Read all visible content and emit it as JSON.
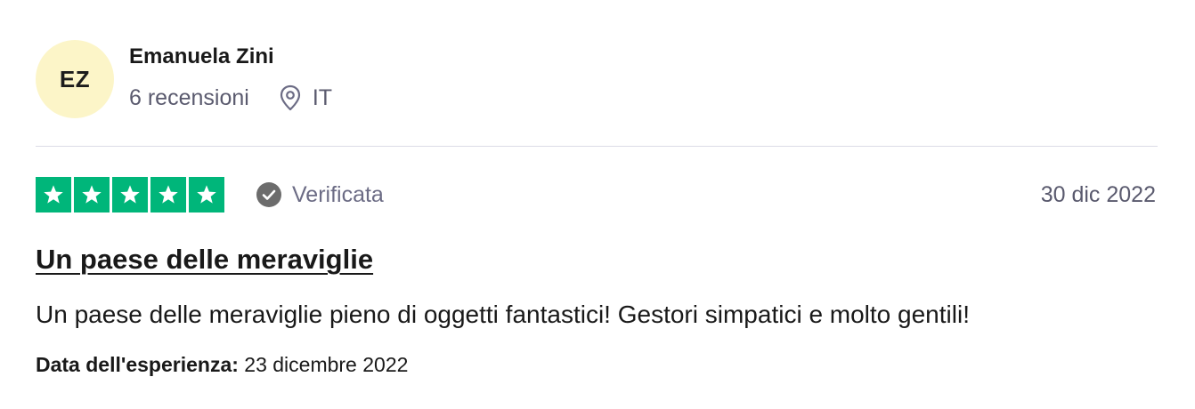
{
  "reviewer": {
    "initials": "EZ",
    "name": "Emanuela Zini",
    "reviews_count": "6 recensioni",
    "country": "IT",
    "location_icon": "location-pin-icon",
    "avatar_bg": "#fcf5c8"
  },
  "review": {
    "rating": 5,
    "rating_max": 5,
    "star_color": "#00b67a",
    "star_icon": "star-icon",
    "verified_label": "Verificata",
    "verified_icon": "check-circle-icon",
    "date": "30 dic 2022",
    "title": "Un paese delle meraviglie",
    "body": "Un paese delle meraviglie pieno di oggetti fantastici! Gestori simpatici e molto gentili!",
    "experience_label": "Data dell'esperienza:",
    "experience_date": "23 dicembre 2022"
  }
}
